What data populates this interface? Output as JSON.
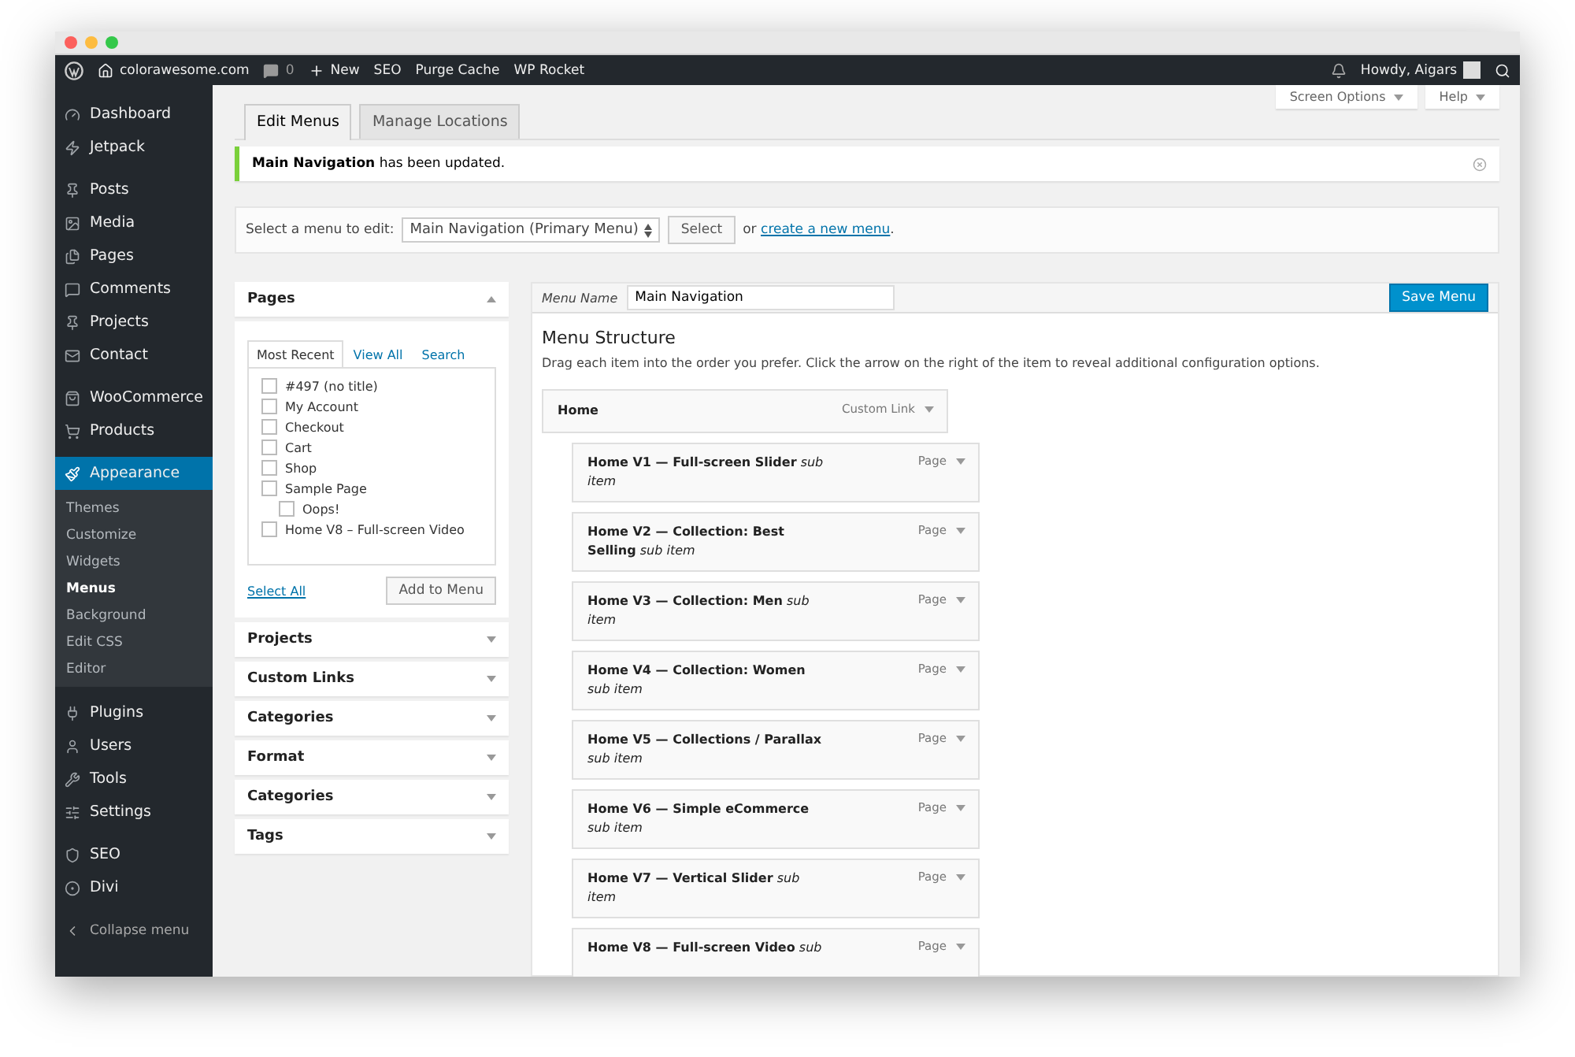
{
  "admin_bar": {
    "site": "colorawesome.com",
    "comments": "0",
    "new": "New",
    "links": [
      "SEO",
      "Purge Cache",
      "WP Rocket"
    ],
    "greeting": "Howdy, Aigars"
  },
  "sidebar": {
    "groups": [
      [
        {
          "label": "Dashboard",
          "selected": false
        },
        {
          "label": "Jetpack",
          "selected": false
        }
      ],
      [
        {
          "label": "Posts",
          "selected": false
        },
        {
          "label": "Media",
          "selected": false
        },
        {
          "label": "Pages",
          "selected": false
        },
        {
          "label": "Comments",
          "selected": false
        },
        {
          "label": "Projects",
          "selected": false
        },
        {
          "label": "Contact",
          "selected": false
        }
      ],
      [
        {
          "label": "WooCommerce",
          "selected": false
        },
        {
          "label": "Products",
          "selected": false
        }
      ],
      [
        {
          "label": "Appearance",
          "selected": true,
          "submenu": [
            {
              "label": "Themes",
              "selected": false
            },
            {
              "label": "Customize",
              "selected": false
            },
            {
              "label": "Widgets",
              "selected": false
            },
            {
              "label": "Menus",
              "selected": true
            },
            {
              "label": "Background",
              "selected": false
            },
            {
              "label": "Edit CSS",
              "selected": false
            },
            {
              "label": "Editor",
              "selected": false
            }
          ]
        }
      ],
      [
        {
          "label": "Plugins",
          "selected": false
        },
        {
          "label": "Users",
          "selected": false
        },
        {
          "label": "Tools",
          "selected": false
        },
        {
          "label": "Settings",
          "selected": false
        }
      ],
      [
        {
          "label": "SEO",
          "selected": false
        },
        {
          "label": "Divi",
          "selected": false
        }
      ]
    ],
    "collapse": "Collapse menu"
  },
  "screen_tabs": [
    "Screen Options",
    "Help"
  ],
  "tabs": [
    {
      "label": "Edit Menus",
      "selected": true
    },
    {
      "label": "Manage Locations",
      "selected": false
    }
  ],
  "notice": "**Main Navigation** has been updated.",
  "select_bar": {
    "label": "Select a menu to edit:",
    "value": "Main Navigation (Primary Menu)",
    "button": "Select",
    "or": "or",
    "link": "create a new menu",
    "end": "."
  },
  "accordion": [
    {
      "title": "Pages",
      "expanded": true,
      "tabs": [
        {
          "label": "Most Recent",
          "selected": true
        },
        {
          "label": "View All",
          "selected": false
        },
        {
          "label": "Search",
          "selected": false
        }
      ],
      "items": [
        {
          "label": "#497 (no title)",
          "checked": false
        },
        {
          "label": "My Account",
          "checked": false
        },
        {
          "label": "Checkout",
          "checked": false
        },
        {
          "label": "Cart",
          "checked": false
        },
        {
          "label": "Shop",
          "checked": false
        },
        {
          "label": "Sample Page",
          "checked": false,
          "children": [
            {
              "label": "Oops!",
              "checked": false
            }
          ]
        },
        {
          "label": "Home V8 – Full-screen Video",
          "checked": false
        }
      ],
      "select_all": "Select All",
      "add_button": "Add to Menu"
    },
    {
      "title": "Projects",
      "expanded": false
    },
    {
      "title": "Custom Links",
      "expanded": false
    },
    {
      "title": "Categories",
      "expanded": false
    },
    {
      "title": "Format",
      "expanded": false
    },
    {
      "title": "Categories",
      "expanded": false
    },
    {
      "title": "Tags",
      "expanded": false
    }
  ],
  "menu_editor": {
    "name_label": "Menu Name",
    "name_value": "Main Navigation",
    "save": "Save Menu",
    "heading": "Menu Structure",
    "description": "Drag each item into the order you prefer. Click the arrow on the right of the item to reveal additional configuration options.",
    "items": [
      {
        "title": "Home",
        "type": "Custom Link",
        "children": [
          {
            "title": "**Home V1 — Full-screen Slider** *sub item*",
            "type": "Page"
          },
          {
            "title": "**Home V2 — Collection: Best Selling** *sub item*",
            "type": "Page"
          },
          {
            "title": "**Home V3 — Collection: Men** *sub item*",
            "type": "Page"
          },
          {
            "title": "**Home V4 — Collection: Women** *sub item*",
            "type": "Page"
          },
          {
            "title": "**Home V5 — Collections / Parallax** *sub item*",
            "type": "Page"
          },
          {
            "title": "**Home V6 — Simple eCommerce** *sub item*",
            "type": "Page"
          },
          {
            "title": "**Home V7 — Vertical Slider** *sub item*",
            "type": "Page"
          },
          {
            "title": "**Home V8 — Full-screen Video** *sub*",
            "type": "Page"
          }
        ]
      }
    ]
  }
}
